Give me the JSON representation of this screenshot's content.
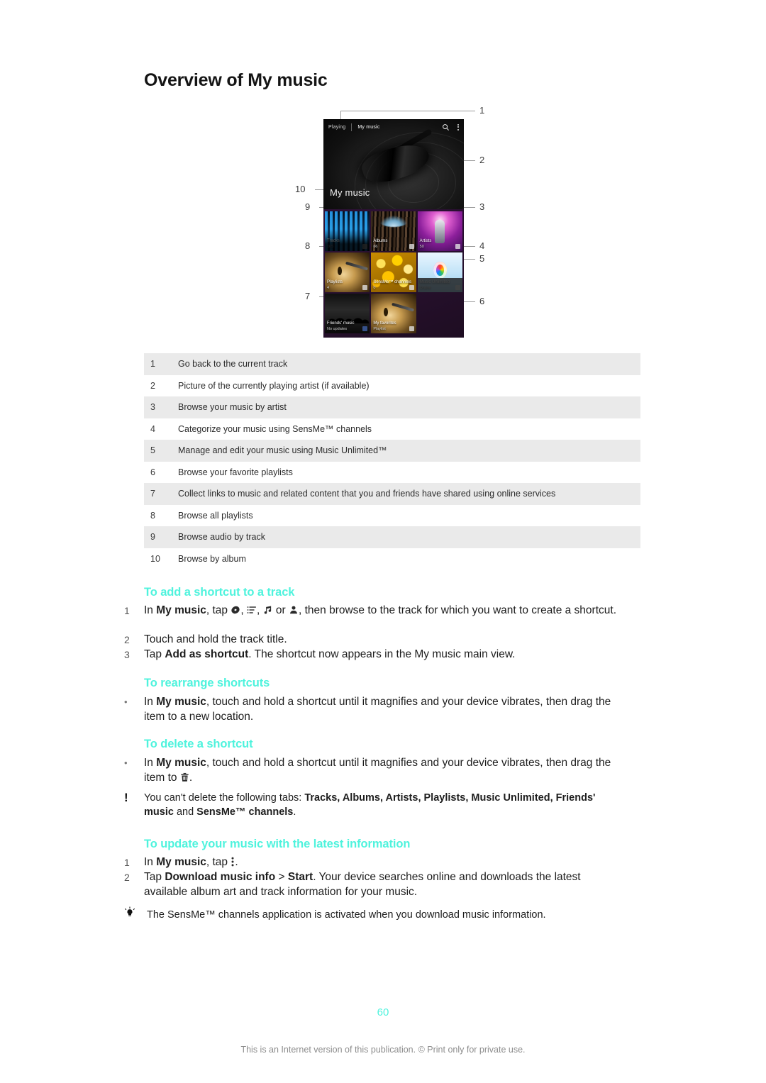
{
  "document": {
    "title": "Overview of My music",
    "page_number": "60",
    "footer": "This is an Internet version of this publication. © Print only for private use."
  },
  "figure": {
    "name": "my-music-screen-diagram",
    "phone": {
      "tab_playing": "Playing",
      "tab_my_music": "My music",
      "screen_title": "My music",
      "search_icon": "search-icon",
      "overflow_icon": "overflow-menu-icon",
      "tiles": [
        {
          "label": "Tracks",
          "sub": "165",
          "badge": "music-note-icon"
        },
        {
          "label": "Albums",
          "sub": "66",
          "badge": "disc-icon"
        },
        {
          "label": "Artists",
          "sub": "50",
          "badge": "person-icon"
        },
        {
          "label": "Playlists",
          "sub": "4",
          "badge": "list-icon"
        },
        {
          "label": "SensMe™ channels",
          "sub": "0",
          "badge": "sensme-icon"
        },
        {
          "label": "Music Unlimited",
          "sub": "Online",
          "badge": "music-unlimited-icon"
        },
        {
          "label": "Friends' music",
          "sub": "No updates",
          "badge": "facebook-icon"
        },
        {
          "label": "My favorites",
          "sub": "Playlist",
          "badge": "playlist-icon"
        }
      ]
    },
    "callouts": [
      "1",
      "2",
      "3",
      "4",
      "5",
      "6",
      "7",
      "8",
      "9",
      "10"
    ]
  },
  "reference_table": {
    "rows": [
      {
        "num": "1",
        "desc": "Go back to the current track"
      },
      {
        "num": "2",
        "desc": "Picture of the currently playing artist (if available)"
      },
      {
        "num": "3",
        "desc": "Browse your music by artist"
      },
      {
        "num": "4",
        "desc": "Categorize your music using SensMe™ channels"
      },
      {
        "num": "5",
        "desc": "Manage and edit your music using Music Unlimited™"
      },
      {
        "num": "6",
        "desc": "Browse your favorite playlists"
      },
      {
        "num": "7",
        "desc": "Collect links to music and related content that you and friends have shared using online services"
      },
      {
        "num": "8",
        "desc": "Browse all playlists"
      },
      {
        "num": "9",
        "desc": "Browse audio by track"
      },
      {
        "num": "10",
        "desc": "Browse by album"
      }
    ]
  },
  "sections": {
    "add_shortcut": {
      "heading": "To add a shortcut to a track",
      "steps": [
        {
          "marker": "1",
          "text_parts": {
            "p1": "In ",
            "b1": "My music",
            "p2": ", tap ",
            "icons": [
              "disc-icon",
              "list-icon",
              "music-note-icon",
              "person-icon"
            ],
            "p3": ", then browse to the track for which you want to create a shortcut."
          }
        },
        {
          "marker": "2",
          "text": "Touch and hold the track title."
        },
        {
          "marker": "3",
          "text_parts": {
            "p1": "Tap ",
            "b1": "Add as shortcut",
            "p2": ". The shortcut now appears in the My music main view."
          }
        }
      ]
    },
    "rearrange_shortcuts": {
      "heading": "To rearrange shortcuts",
      "bullet": {
        "marker": "•",
        "p1": "In ",
        "b1": "My music",
        "p2": ", touch and hold a shortcut until it magnifies and your device vibrates, then drag the item to a new location."
      }
    },
    "delete_shortcut": {
      "heading": "To delete a shortcut",
      "bullet": {
        "marker": "•",
        "p1": "In ",
        "b1": "My music",
        "p2": ", touch and hold a shortcut until it magnifies and your device vibrates, then drag the item to ",
        "icon": "trash-icon",
        "p3": "."
      },
      "note": {
        "marker": "!",
        "p1": "You can't delete the following tabs: ",
        "b1": "Tracks, Albums, Artists, Playlists, Music Unlimited, Friends' music",
        "p2": " and ",
        "b2": "SensMe™ channels",
        "p3": "."
      }
    },
    "update_music": {
      "heading": "To update your music with the latest information",
      "steps": [
        {
          "marker": "1",
          "p1": "In ",
          "b1": "My music",
          "p2": ", tap ",
          "icon": "overflow-menu-icon",
          "p3": "."
        },
        {
          "marker": "2",
          "p1": "Tap ",
          "b1": "Download music info",
          "p2": " > ",
          "b2": "Start",
          "p3": ". Your device searches online and downloads the latest available album art and track information for your music."
        }
      ],
      "tip": {
        "marker": "tip-bulb-icon",
        "text": "The SensMe™ channels application is activated when you download music information."
      }
    }
  },
  "colors": {
    "accent_teal": "#4ff3dd",
    "table_shade": "#eaeaea",
    "body_text": "#1d1d1d"
  }
}
